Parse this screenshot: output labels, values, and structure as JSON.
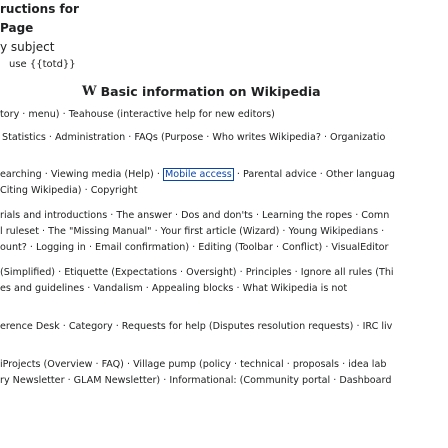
{
  "top": {
    "line1": "ructions for",
    "line2": "Page",
    "line3": "y subject",
    "line4": "use {{totd}}"
  },
  "header": {
    "logo": "W",
    "title": "Basic information on Wikipedia"
  },
  "rows": {
    "r1": "tory · menu) · Teahouse (interactive help for new editors)",
    "r2": "Statistics · Administration · FAQs (Purpose · Who writes Wikipedia? · Organizatio",
    "r3_a": "earching · Viewing media (Help) · ",
    "r3_hl": "Mobile access",
    "r3_b": " · Parental advice · Other languag",
    "r4": "Citing Wikipedia) · Copyright",
    "r5": "rials and introductions · The answer · Dos and don'ts · Learning the ropes · Comn",
    "r6": "l ruleset · The \"Missing Manual\" · Your first article (Wizard) · Young Wikipedians ·",
    "r7": "ount? · Logging in · Email confirmation) · Editing (Toolbar · Conflict) · VisualEditor",
    "r8": "(Simplified) · Etiquette (Expectations · Oversight) · Principles · Ignore all rules (Thi",
    "r9": "es and guidelines · Vandalism · Appealing blocks · What Wikipedia is not",
    "r10": "erence Desk · Category · Requests for help (Disputes resolution requests) · IRC liv",
    "r11": "iProjects (Overview · FAQ) · Village pump (policy · technical · proposals · idea lab",
    "r12": "ry Newsletter · GLAM Newsletter) · Informational: (Community portal · Dashboard"
  }
}
